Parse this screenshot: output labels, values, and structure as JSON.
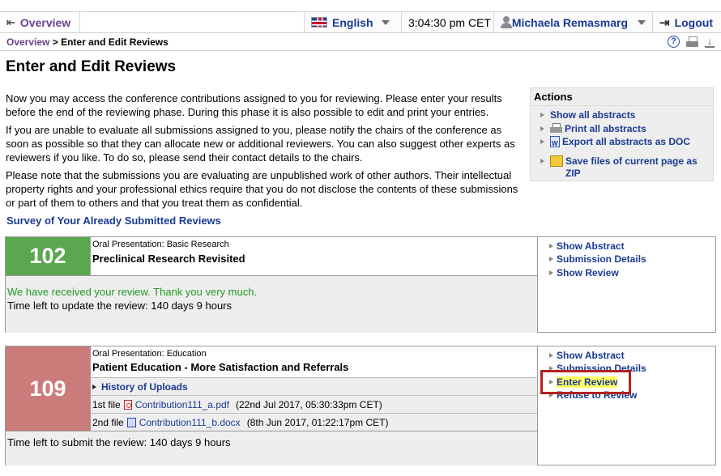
{
  "topbar": {
    "overview_label": "Overview",
    "language": "English",
    "time": "3:04:30 pm CET",
    "user": "Michaela Remasmarg",
    "logout_label": "Logout"
  },
  "breadcrumb": {
    "root": "Overview",
    "separator": " > ",
    "current": "Enter and Edit Reviews"
  },
  "page_title": "Enter and Edit Reviews",
  "intro": {
    "p1": "Now you may access the conference contributions assigned to you for reviewing. Please enter your results before the end of the reviewing phase. During this phase it is also possible to edit and print your entries.",
    "p2": "If you are unable to evaluate all submissions assigned to you, please notify the chairs of the conference as soon as possible so that they can allocate new or additional reviewers. You can also suggest other experts as reviewers if you like. To do so, please send their contact details to the chairs.",
    "p3": "Please note that the submissions you are evaluating are unpublished work of other authors. Their intellectual property rights and your professional ethics require that you do not disclose the contents of these submissions or part of them to others and that you treat them as confidential."
  },
  "survey_link": "Survey of Your Already Submitted Reviews",
  "actions": {
    "heading": "Actions",
    "items": [
      "Show all abstracts",
      "Print all abstracts",
      "Export all abstracts as DOC",
      "Save files of current page as ZIP"
    ]
  },
  "submissions": [
    {
      "number": "102",
      "color": "#5aa74f",
      "category": "Oral Presentation: Basic Research",
      "title": "Preclinical Research Revisited",
      "status_message": "We have received your review. Thank you very much.",
      "time_left": "Time left to update the review: 140 days 9 hours",
      "links": [
        "Show Abstract",
        "Submission Details",
        "Show Review"
      ]
    },
    {
      "number": "109",
      "color": "#cc7b7b",
      "category": "Oral Presentation: Education",
      "title": "Patient Education - More Satisfaction and Referrals",
      "history_label": "History of Uploads",
      "files": [
        {
          "label": "1st file",
          "name": "Contribution111_a.pdf",
          "date": "(22nd Jul 2017, 05:30:33pm CET)"
        },
        {
          "label": "2nd file",
          "name": "Contribution111_b.docx",
          "date": "(8th Jun 2017, 01:22:17pm CET)"
        }
      ],
      "time_left": "Time left to submit the review: 140 days 9 hours",
      "links": [
        "Show Abstract",
        "Submission Details",
        "Enter Review",
        "Refuse to Review"
      ]
    }
  ]
}
